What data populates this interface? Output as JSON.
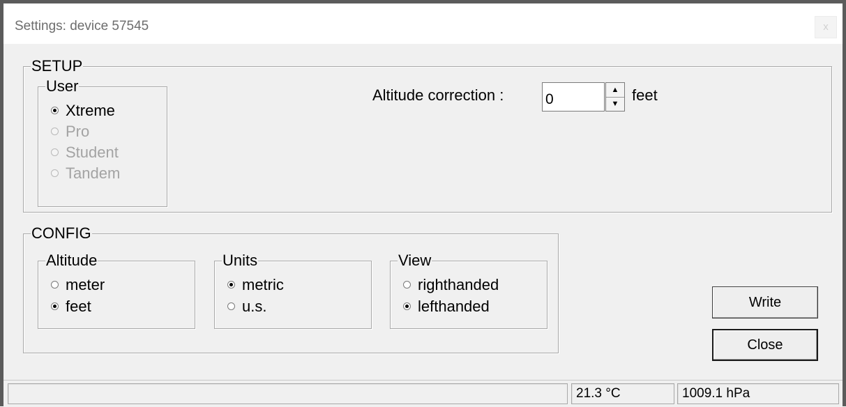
{
  "window": {
    "title": "Settings: device 57545",
    "close_symbol": "x"
  },
  "setup": {
    "legend": "SETUP",
    "user": {
      "legend": "User",
      "options": [
        {
          "label": "Xtreme",
          "selected": true,
          "enabled": true
        },
        {
          "label": "Pro",
          "selected": false,
          "enabled": false
        },
        {
          "label": "Student",
          "selected": false,
          "enabled": false
        },
        {
          "label": "Tandem",
          "selected": false,
          "enabled": false
        }
      ]
    },
    "altitude_correction": {
      "label": "Altitude correction :",
      "value": "0",
      "unit": "feet",
      "up_arrow": "▲",
      "down_arrow": "▼"
    }
  },
  "config": {
    "legend": "CONFIG",
    "altitude": {
      "legend": "Altitude",
      "options": [
        {
          "label": "meter",
          "selected": false
        },
        {
          "label": "feet",
          "selected": true
        }
      ]
    },
    "units": {
      "legend": "Units",
      "options": [
        {
          "label": "metric",
          "selected": true
        },
        {
          "label": "u.s.",
          "selected": false
        }
      ]
    },
    "view": {
      "legend": "View",
      "options": [
        {
          "label": "righthanded",
          "selected": false
        },
        {
          "label": "lefthanded",
          "selected": true
        }
      ]
    }
  },
  "buttons": {
    "write": "Write",
    "close": "Close"
  },
  "status": {
    "main": "",
    "temperature": "21.3 °C",
    "pressure": "1009.1 hPa"
  }
}
